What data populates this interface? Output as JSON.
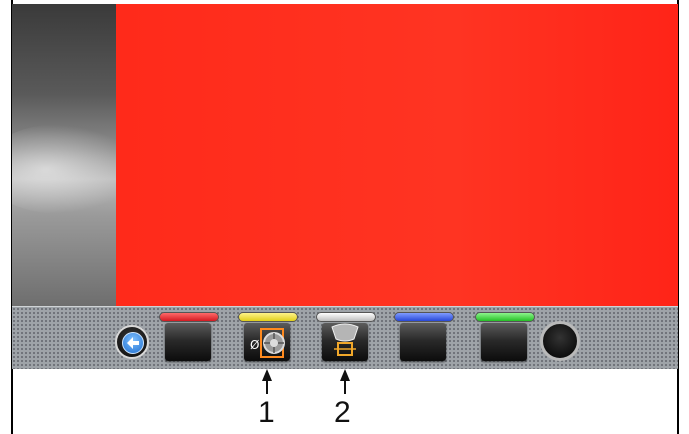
{
  "display": {
    "color": "#ff2e1e"
  },
  "toolbar": {
    "buttons": [
      {
        "name": "back-arrow-icon",
        "led": null
      },
      {
        "name": "soft-key-1",
        "led": "#e8232b"
      },
      {
        "name": "rim-diameter-icon",
        "led": "#efe43a",
        "symbol": "Ø"
      },
      {
        "name": "rim-width-icon",
        "led": "#d8d8d8"
      },
      {
        "name": "soft-key-4",
        "led": "#3a5fe8"
      },
      {
        "name": "soft-key-5",
        "led": "#3cd23c"
      },
      {
        "name": "round-key",
        "led": null
      }
    ]
  },
  "callouts": [
    {
      "label": "1"
    },
    {
      "label": "2"
    }
  ]
}
